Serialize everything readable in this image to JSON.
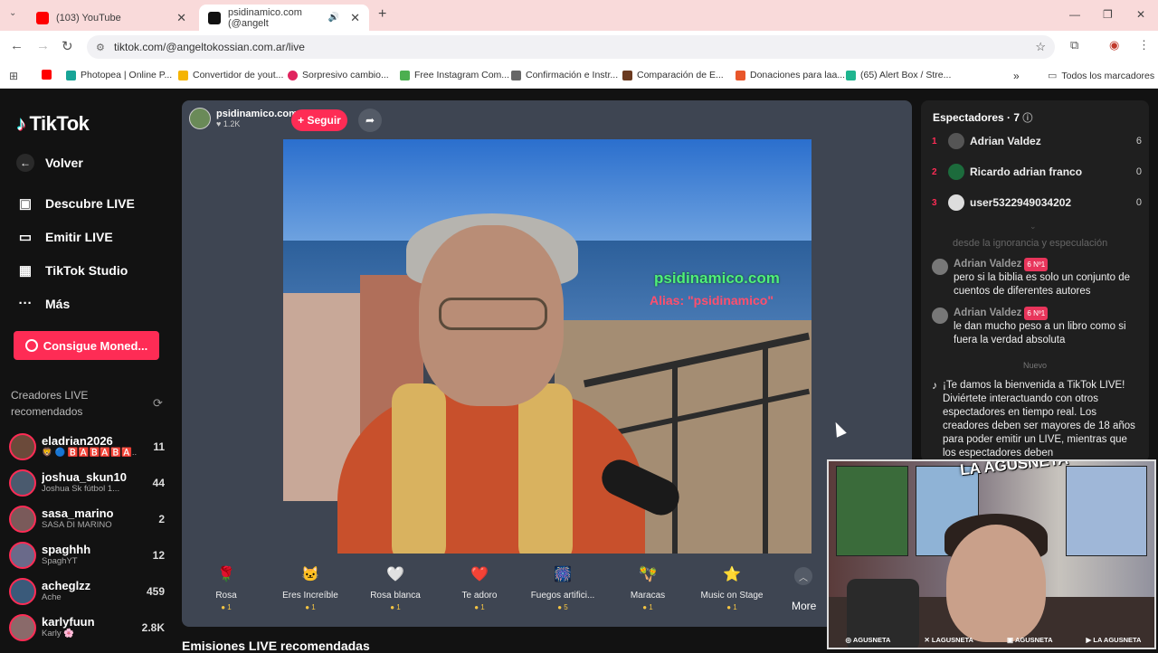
{
  "browser": {
    "tabs": [
      {
        "label": "(103) YouTube",
        "icon": "youtube-icon"
      },
      {
        "label": "psidinamico.com (@angelt",
        "icon": "tiktok-icon"
      }
    ],
    "new_tab": "+",
    "url": "tiktok.com/@angeltokossian.com.ar/live",
    "bookmarks": [
      {
        "label": "Photopea | Online P...",
        "color": "#18a497"
      },
      {
        "label": "Convertidor de yout...",
        "color": "#f5b400"
      },
      {
        "label": "Sorpresivo cambio...",
        "color": "#e0245e"
      },
      {
        "label": "Free Instagram Com...",
        "color": "#4caf50"
      },
      {
        "label": "Confirmación e Instr...",
        "color": "#666666"
      },
      {
        "label": "Comparación de E...",
        "color": "#6b3a1f"
      },
      {
        "label": "Donaciones para laa...",
        "color": "#e8562a"
      },
      {
        "label": "(65) Alert Box / Stre...",
        "color": "#1fb58f"
      }
    ],
    "all_bookmarks": "Todos los marcadores"
  },
  "sidebar": {
    "logo": "TikTok",
    "back": "Volver",
    "nav": [
      {
        "label": "Descubre LIVE",
        "icon": "calendar-live-icon"
      },
      {
        "label": "Emitir LIVE",
        "icon": "video-camera-icon"
      },
      {
        "label": "TikTok Studio",
        "icon": "studio-icon"
      },
      {
        "label": "Más",
        "icon": "more-dots-icon"
      }
    ],
    "coins_button": "Consigue Moned...",
    "recommended_title": "Creadores LIVE recomendados",
    "creators": [
      {
        "name": "eladrian2026",
        "sub": "🦁 🔵 🅱️🅰️🅱️🅰️🅱️🅰️..",
        "count": "11",
        "color": "#6b4a3a"
      },
      {
        "name": "joshua_skun10",
        "sub": "Joshua Sk fútbol 1...",
        "count": "44",
        "color": "#4a5a6e"
      },
      {
        "name": "sasa_marino",
        "sub": "SASA DI MARINO",
        "count": "2",
        "color": "#7a5a5a"
      },
      {
        "name": "spaghhh",
        "sub": "SpaghYT",
        "count": "12",
        "color": "#6a6a8a"
      },
      {
        "name": "acheglzz",
        "sub": "Ache",
        "count": "459",
        "color": "#3a5a7a"
      },
      {
        "name": "karlyfuun",
        "sub": "Karly 🌸",
        "count": "2.8K",
        "color": "#8a6a6a"
      }
    ]
  },
  "live": {
    "host_name": "psidinamico.com",
    "host_likes": "♥ 1.2K",
    "follow": "+ Seguir",
    "overlay_site": "psidinamico.com",
    "overlay_alias": "Alias: \"psidinamico\"",
    "gifts": [
      {
        "name": "Rosa",
        "price": "1",
        "emoji": "🌹"
      },
      {
        "name": "Eres Increíble",
        "price": "1",
        "emoji": "🐱"
      },
      {
        "name": "Rosa blanca",
        "price": "1",
        "emoji": "🤍"
      },
      {
        "name": "Te adoro",
        "price": "1",
        "emoji": "❤️"
      },
      {
        "name": "Fuegos artifici...",
        "price": "5",
        "emoji": "🎆"
      },
      {
        "name": "Maracas",
        "price": "1",
        "emoji": "🪇"
      },
      {
        "name": "Music on Stage",
        "price": "1",
        "emoji": "⭐"
      }
    ],
    "more": "More",
    "recommended_live": "Emisiones LIVE recomendadas"
  },
  "chat": {
    "viewers_title": "Espectadores · 7",
    "viewers": [
      {
        "rank": "1",
        "name": "Adrian Valdez",
        "score": "6",
        "color": "#555555"
      },
      {
        "rank": "2",
        "name": "Ricardo adrian franco",
        "score": "0",
        "color": "#1c6b3c"
      },
      {
        "rank": "3",
        "name": "user5322949034202",
        "score": "0",
        "color": "#dddddd"
      }
    ],
    "faded_text": "desde la ignorancia y especulación",
    "messages": [
      {
        "user": "Adrian Valdez",
        "badge": "6 Nº1",
        "text": "pero si la biblia es solo un conjunto de cuentos de diferentes autores"
      },
      {
        "user": "Adrian Valdez",
        "badge": "6 Nº1",
        "text": "le dan mucho peso a un libro como si fuera la verdad absoluta"
      }
    ],
    "new_label": "Nuevo",
    "welcome": "¡Te damos la bienvenida a TikTok LIVE! Diviértete interactuando con otros espectadores en tiempo real. Los creadores deben ser mayores de 18 años para poder emitir un LIVE, mientras que los espectadores deben"
  },
  "webcam": {
    "logo": "LA AGUSNETA",
    "footer": [
      "AGUSNETA",
      "LAGUSNETA",
      "AGUSNETA",
      "LA AGUSNETA"
    ]
  }
}
